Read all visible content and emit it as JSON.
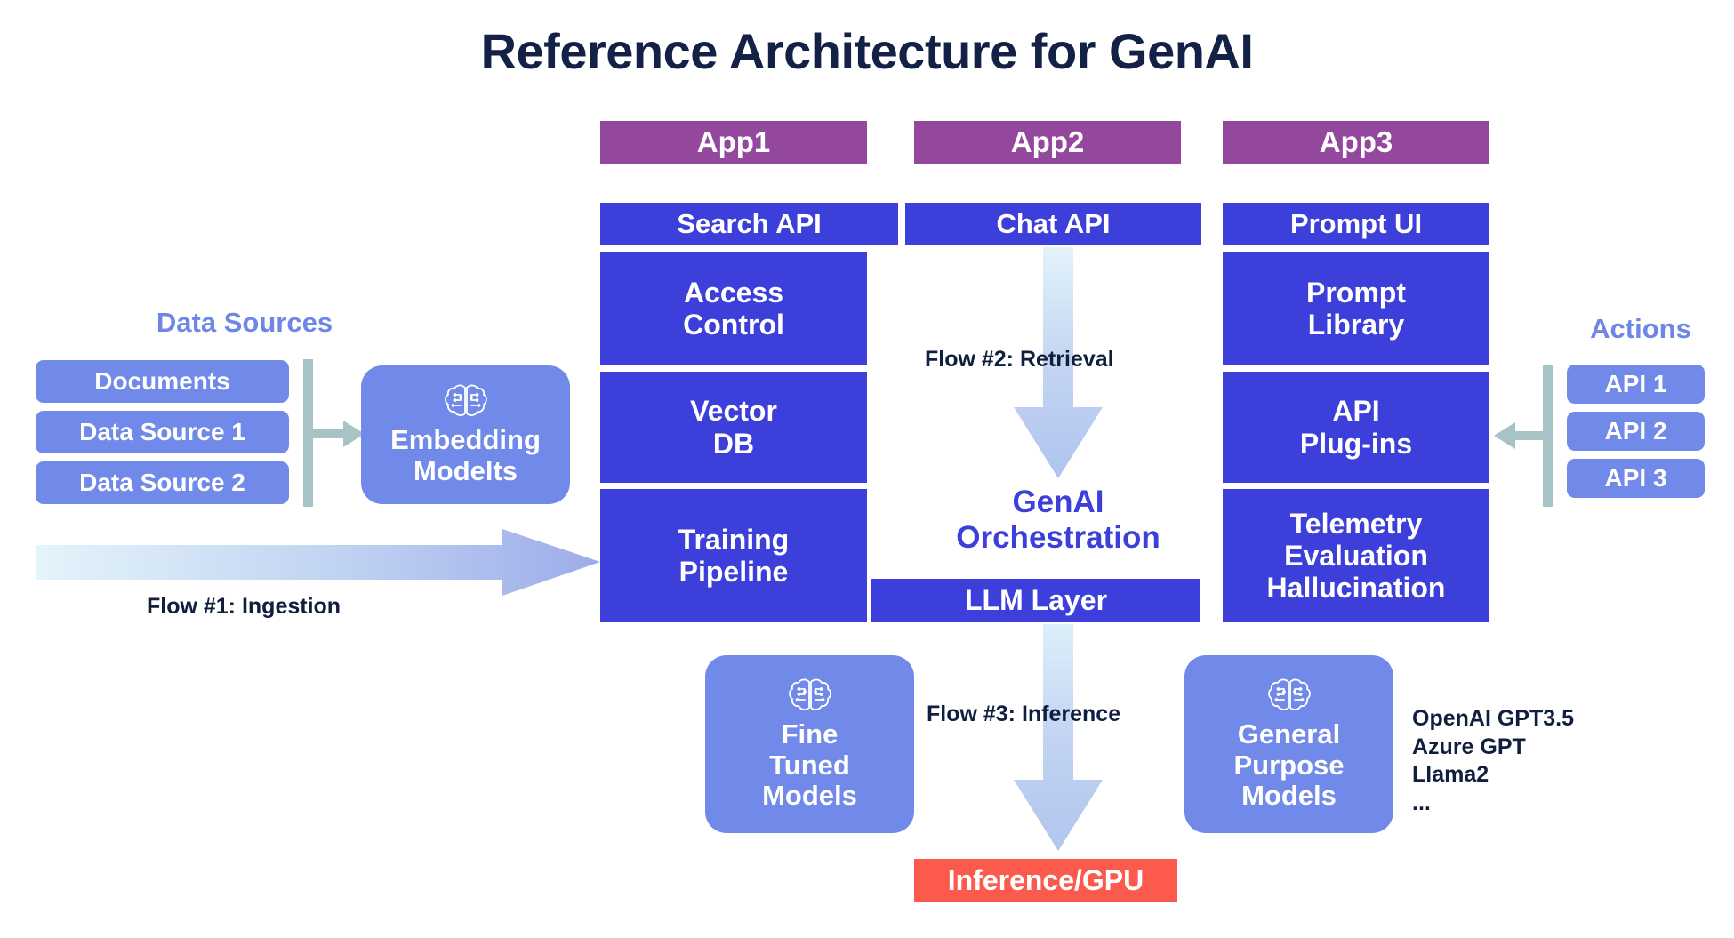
{
  "title": "Reference Architecture for GenAI",
  "apps": [
    {
      "name": "App1",
      "api": "Search API",
      "rows": [
        "Access\nControl",
        "Vector\nDB",
        "Training\nPipeline"
      ]
    },
    {
      "name": "App2",
      "api": "Chat API",
      "rows": []
    },
    {
      "name": "App3",
      "api": "Prompt UI",
      "rows": [
        "Prompt\nLibrary",
        "API\nPlug-ins",
        "Telemetry\nEvaluation\nHallucination"
      ]
    }
  ],
  "app_headers": {
    "app1": "App1",
    "app2": "App2",
    "app3": "App3"
  },
  "api_bars": {
    "search": "Search API",
    "chat": "Chat API",
    "prompt": "Prompt UI"
  },
  "left_column": {
    "access_control_line1": "Access",
    "access_control_line2": "Control",
    "vector_db_line1": "Vector",
    "vector_db_line2": "DB",
    "training_pipeline_line1": "Training",
    "training_pipeline_line2": "Pipeline"
  },
  "right_column": {
    "prompt_library_line1": "Prompt",
    "prompt_library_line2": "Library",
    "api_plugins_line1": "API",
    "api_plugins_line2": "Plug-ins",
    "telemetry_line1": "Telemetry",
    "telemetry_line2": "Evaluation",
    "telemetry_line3": "Hallucination"
  },
  "center_column": {
    "orchestration_line1": "GenAI",
    "orchestration_line2": "Orchestration",
    "llm_layer": "LLM Layer"
  },
  "data_sources": {
    "heading": "Data Sources",
    "items": [
      "Documents",
      "Data Source 1",
      "Data Source 2"
    ],
    "embedding_line1": "Embedding",
    "embedding_line2": "Modelts",
    "embedding_icon": "brain-circuit-icon"
  },
  "actions": {
    "heading": "Actions",
    "items": [
      "API 1",
      "API 2",
      "API 3"
    ]
  },
  "flows": {
    "flow1": "Flow #1: Ingestion",
    "flow2": "Flow #2: Retrieval",
    "flow3": "Flow #3: Inference"
  },
  "models": {
    "fine_tuned_line1": "Fine",
    "fine_tuned_line2": "Tuned",
    "fine_tuned_line3": "Models",
    "general_line1": "General",
    "general_line2": "Purpose",
    "general_line3": "Models",
    "list": [
      "OpenAI GPT3.5",
      "Azure GPT",
      "Llama2",
      "..."
    ]
  },
  "inference": {
    "label": "Inference/GPU"
  },
  "colors": {
    "title": "#122145",
    "purple": "#93489E",
    "blue": "#3D3FDB",
    "periwinkle": "#7189E8",
    "sage": "#A8C3C6",
    "red": "#FB5A4C",
    "heading_blue": "#6E86E6",
    "arrow_light": "#DFF1FB",
    "arrow_dark": "#9DB3EA"
  }
}
